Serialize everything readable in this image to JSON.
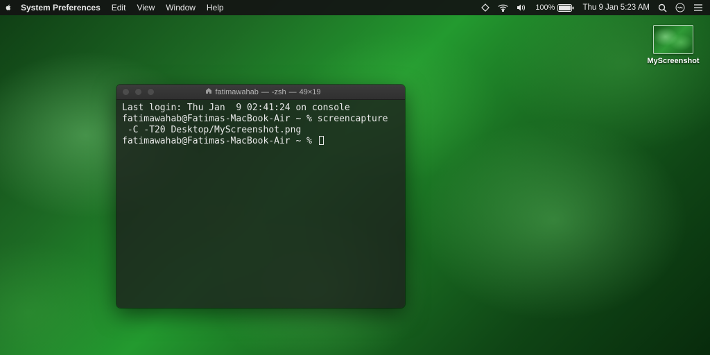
{
  "menubar": {
    "app_name": "System Preferences",
    "items": [
      "Edit",
      "View",
      "Window",
      "Help"
    ],
    "battery_pct": "100%",
    "clock": "Thu 9 Jan  5:23 AM"
  },
  "desktop": {
    "icons": [
      {
        "label": "MyScreenshot"
      }
    ]
  },
  "terminal": {
    "title_user": "fatimawahab",
    "title_shell": "-zsh",
    "title_dims": "49×19",
    "lines": [
      "Last login: Thu Jan  9 02:41:24 on console",
      "fatimawahab@Fatimas-MacBook-Air ~ % screencapture",
      " -C -T20 Desktop/MyScreenshot.png",
      "fatimawahab@Fatimas-MacBook-Air ~ % "
    ]
  }
}
